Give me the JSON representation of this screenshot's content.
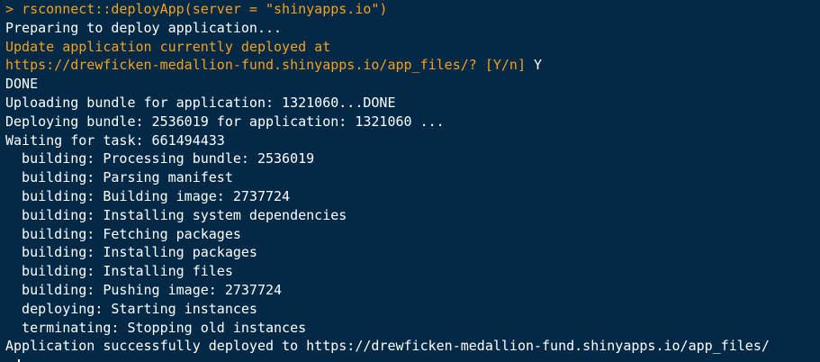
{
  "console": {
    "prompt_symbol": ">",
    "command": "rsconnect::deployApp(server = \"shinyapps.io\")",
    "lines": [
      "Preparing to deploy application...",
      "Update application currently deployed at",
      "https://drewficken-medallion-fund.shinyapps.io/app_files/? [Y/n] ",
      "DONE",
      "Uploading bundle for application: 1321060...DONE",
      "Deploying bundle: 2536019 for application: 1321060 ...",
      "Waiting for task: 661494433",
      "  building: Processing bundle: 2536019",
      "  building: Parsing manifest",
      "  building: Building image: 2737724",
      "  building: Installing system dependencies",
      "  building: Fetching packages",
      "  building: Installing packages",
      "  building: Installing files",
      "  building: Pushing image: 2737724",
      "  deploying: Starting instances",
      "  terminating: Stopping old instances",
      "Application successfully deployed to https://drewficken-medallion-fund.shinyapps.io/app_files/"
    ],
    "user_answer": "Y"
  },
  "colors": {
    "background": "#032946",
    "text": "#ffffff",
    "accent": "#f3a21c"
  }
}
